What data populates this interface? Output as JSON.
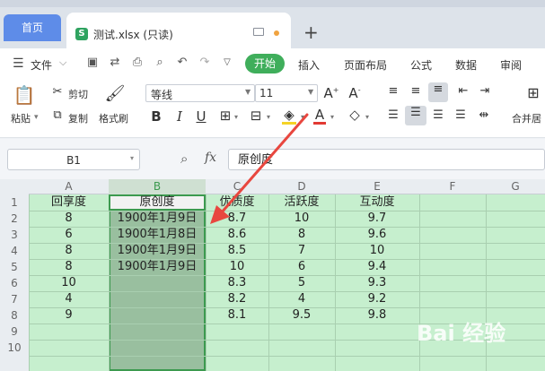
{
  "tabs": {
    "home": "首页",
    "file": "测试.xlsx (只读)",
    "new": "+"
  },
  "menu": {
    "file": "文件",
    "items": [
      "开始",
      "插入",
      "页面布局",
      "公式",
      "数据",
      "审阅"
    ]
  },
  "ribbon": {
    "paste": "粘贴",
    "cut": "剪切",
    "copy": "复制",
    "format_painter": "格式刷",
    "font_name": "等线",
    "font_size": "11",
    "merge": "合并居"
  },
  "formula_bar": {
    "cell_ref": "B1",
    "fx": "fx",
    "content": "原创度"
  },
  "grid": {
    "columns": [
      "A",
      "B",
      "C",
      "D",
      "E",
      "F",
      "G"
    ],
    "rows": [
      "1",
      "2",
      "3",
      "4",
      "5",
      "6",
      "7",
      "8",
      "9",
      "10"
    ],
    "data": [
      [
        "回享度",
        "原创度",
        "优质度",
        "活跃度",
        "互动度"
      ],
      [
        "8",
        "1900年1月9日",
        "8.7",
        "10",
        "9.7"
      ],
      [
        "6",
        "1900年1月8日",
        "8.6",
        "8",
        "9.6"
      ],
      [
        "8",
        "1900年1月9日",
        "8.5",
        "7",
        "10"
      ],
      [
        "8",
        "1900年1月9日",
        "10",
        "6",
        "9.4"
      ],
      [
        "10",
        "",
        "8.3",
        "5",
        "9.3"
      ],
      [
        "4",
        "",
        "8.2",
        "4",
        "9.2"
      ],
      [
        "9",
        "",
        "8.1",
        "9.5",
        "9.8"
      ]
    ]
  },
  "watermark": "Bai 经验",
  "colors": {
    "accent_green": "#3fae5b",
    "selection_border": "#3c9a4f",
    "arrow": "#e8473f"
  }
}
